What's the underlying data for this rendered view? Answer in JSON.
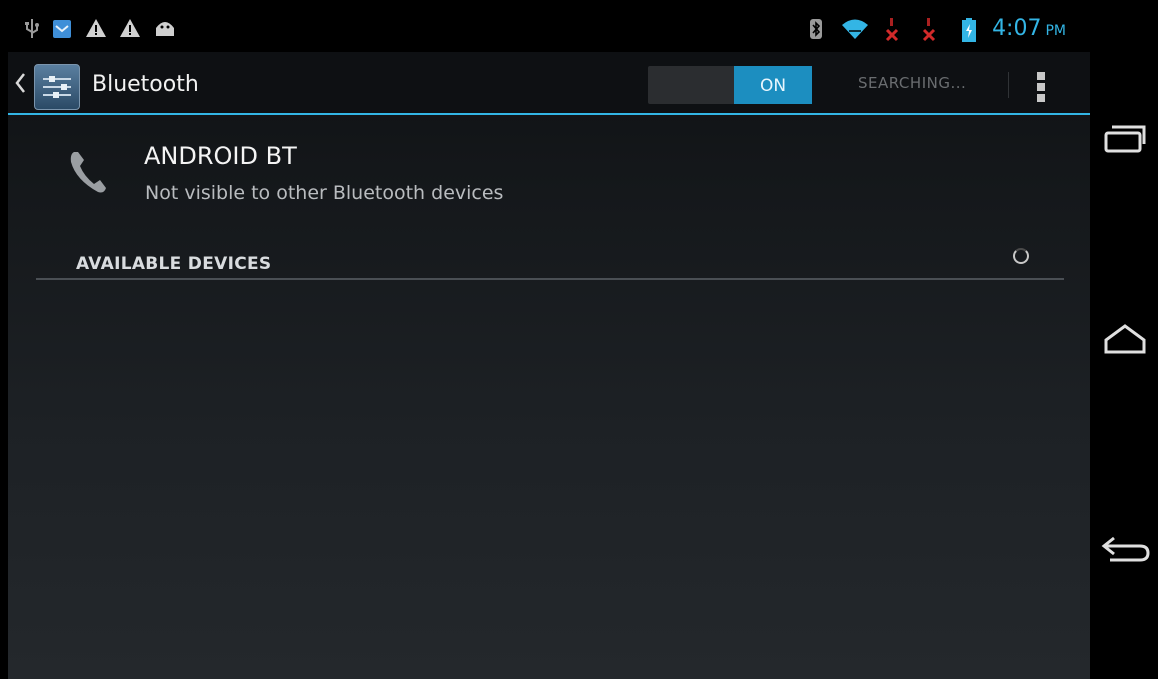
{
  "status_bar": {
    "left_icons": [
      "usb-icon",
      "email-icon",
      "warning-icon",
      "warning-icon",
      "android-icon"
    ],
    "right_icons": [
      "bluetooth-icon",
      "wifi-icon",
      "no-signal-icon",
      "no-signal-icon",
      "battery-charging-icon"
    ],
    "time": "4:07",
    "ampm": "PM"
  },
  "action_bar": {
    "title": "Bluetooth",
    "toggle_state": "ON",
    "searching_label": "SEARCHING...",
    "app_icon": "settings-icon",
    "overflow_icon": "overflow-menu-icon"
  },
  "device": {
    "name": "ANDROID BT",
    "visibility": "Not visible to other Bluetooth devices",
    "icon": "phone-icon"
  },
  "available_devices": {
    "header": "AVAILABLE DEVICES",
    "progress_icon": "spinner-icon"
  },
  "nav_bar": {
    "buttons": [
      "recent-apps-icon",
      "home-icon",
      "back-icon"
    ]
  },
  "colors": {
    "accent": "#33b5e5",
    "toggle_on": "#1c8ec0",
    "background": "#14171a"
  }
}
